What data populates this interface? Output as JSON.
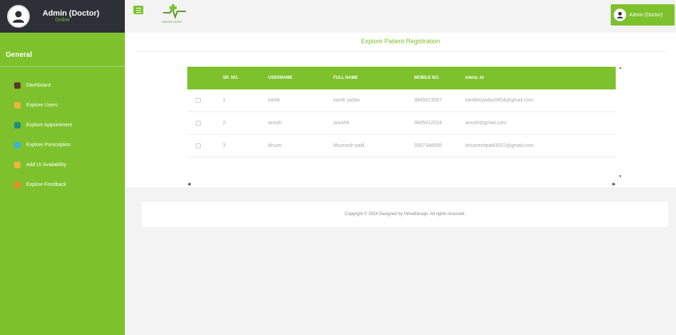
{
  "sidebar": {
    "user": {
      "name": "Admin (Doctor)",
      "status": "Online"
    },
    "section": "General",
    "items": [
      {
        "label": "Dashboard",
        "icon": "home-icon",
        "color": "#5a3a2a"
      },
      {
        "label": "Explore Users",
        "icon": "users-icon",
        "color": "#f2b33d"
      },
      {
        "label": "Explore Appointment",
        "icon": "calendar-icon",
        "color": "#1f8f7a"
      },
      {
        "label": "Explore Prescription",
        "icon": "prescription-icon",
        "color": "#35b6d6"
      },
      {
        "label": "Add Ur Availability",
        "icon": "clock-icon",
        "color": "#f2b33d"
      },
      {
        "label": "Explore Feedback",
        "icon": "feedback-icon",
        "color": "#f08a24"
      }
    ]
  },
  "topbar": {
    "logo_text": "ONLINE CLINIC",
    "user_label": "Admin (Doctor)"
  },
  "page": {
    "title": "Explore Patient Registration"
  },
  "table": {
    "headers": [
      "",
      "SR. NO.",
      "USERNAME",
      "FULL NAME",
      "MOBILE NO.",
      "EMAIL ID"
    ],
    "rows": [
      {
        "sr": "1",
        "username": "kartik",
        "fullname": "kartik yadav",
        "mobile": "9845013067",
        "email": "kartikmyadav0854@gmail.com"
      },
      {
        "sr": "2",
        "username": "anush",
        "fullname": "anushk",
        "mobile": "9845012024",
        "email": "anush@gmail.com"
      },
      {
        "sr": "3",
        "username": "bhumi",
        "fullname": "bhumesh patil",
        "mobile": "9307348695",
        "email": "bhumeshpatil3002@gmail.com"
      }
    ]
  },
  "footer": {
    "text": "Copyright © 2024 Designed by HimalDesign. All rights reserved."
  },
  "colors": {
    "accent": "#7dc22c",
    "dark": "#2d3036"
  }
}
